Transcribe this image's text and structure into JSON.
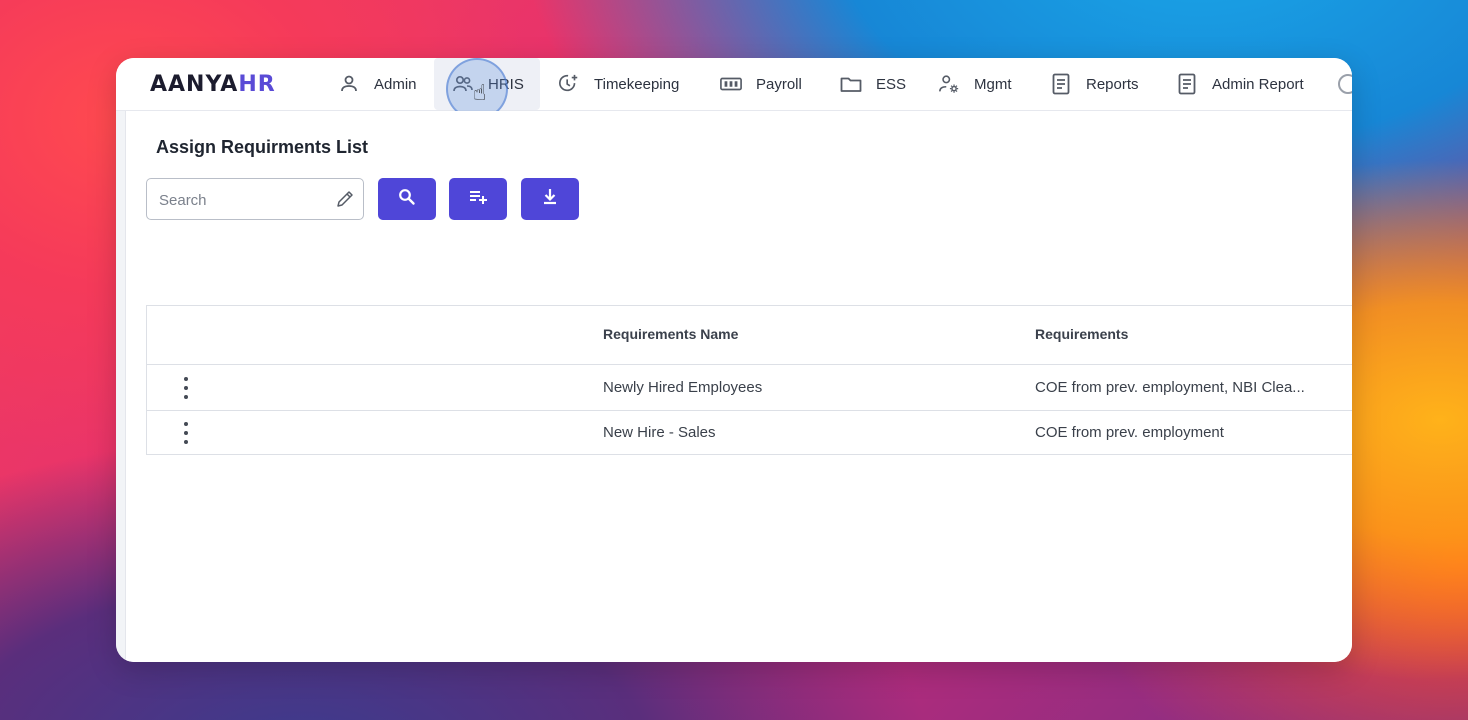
{
  "app": {
    "logo_main": "AANYA",
    "logo_accent": "HR"
  },
  "nav": {
    "items": [
      {
        "label": "Admin",
        "icon": "person-icon"
      },
      {
        "label": "HRIS",
        "icon": "people-icon",
        "active": true
      },
      {
        "label": "Timekeeping",
        "icon": "clock-plus-icon"
      },
      {
        "label": "Payroll",
        "icon": "cash-icon"
      },
      {
        "label": "ESS",
        "icon": "folder-icon"
      },
      {
        "label": "Mgmt",
        "icon": "user-gear-icon"
      },
      {
        "label": "Reports",
        "icon": "document-icon"
      },
      {
        "label": "Admin Report",
        "icon": "document-icon"
      }
    ]
  },
  "page": {
    "title": "Assign Requirments List"
  },
  "toolbar": {
    "search_placeholder": "Search",
    "search_value": "",
    "buttons": [
      {
        "name": "search-button",
        "icon": "search-icon"
      },
      {
        "name": "add-button",
        "icon": "playlist-add-icon"
      },
      {
        "name": "download-button",
        "icon": "download-icon"
      }
    ]
  },
  "table": {
    "columns": [
      "",
      "Requirements Name",
      "Requirements"
    ],
    "rows": [
      {
        "name": "Newly Hired Employees",
        "requirements": "COE from prev. employment, NBI Clea..."
      },
      {
        "name": "New Hire - Sales",
        "requirements": "COE from prev. employment"
      }
    ]
  },
  "colors": {
    "accent": "#4f46d8",
    "logo_accent": "#5a4bd6"
  }
}
